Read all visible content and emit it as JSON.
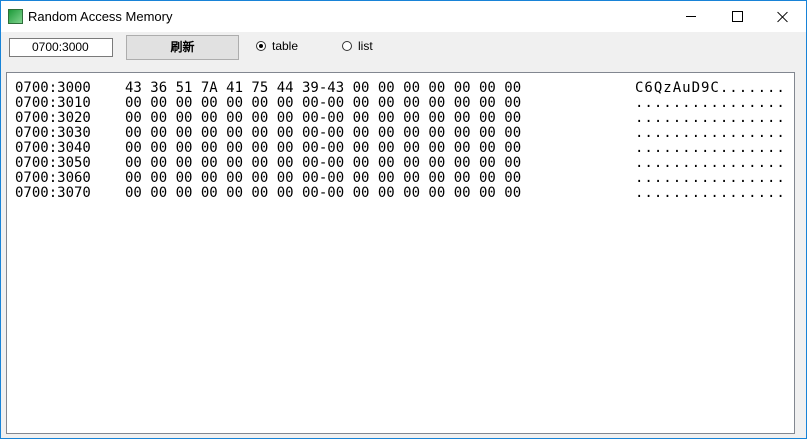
{
  "window": {
    "title": "Random Access Memory",
    "minimize_symbol": "minimize",
    "maximize_symbol": "maximize",
    "close_symbol": "close"
  },
  "toolbar": {
    "address_value": "0700:3000",
    "refresh_label": "刷新",
    "radio_table_label": "table",
    "radio_list_label": "list",
    "selected_mode": "table"
  },
  "memory": {
    "rows": [
      {
        "addr": "0700:3000",
        "hex": "43 36 51 7A 41 75 44 39-43 00 00 00 00 00 00 00",
        "ascii": "C6QzAuD9C......."
      },
      {
        "addr": "0700:3010",
        "hex": "00 00 00 00 00 00 00 00-00 00 00 00 00 00 00 00",
        "ascii": "................"
      },
      {
        "addr": "0700:3020",
        "hex": "00 00 00 00 00 00 00 00-00 00 00 00 00 00 00 00",
        "ascii": "................"
      },
      {
        "addr": "0700:3030",
        "hex": "00 00 00 00 00 00 00 00-00 00 00 00 00 00 00 00",
        "ascii": "................"
      },
      {
        "addr": "0700:3040",
        "hex": "00 00 00 00 00 00 00 00-00 00 00 00 00 00 00 00",
        "ascii": "................"
      },
      {
        "addr": "0700:3050",
        "hex": "00 00 00 00 00 00 00 00-00 00 00 00 00 00 00 00",
        "ascii": "................"
      },
      {
        "addr": "0700:3060",
        "hex": "00 00 00 00 00 00 00 00-00 00 00 00 00 00 00 00",
        "ascii": "................"
      },
      {
        "addr": "0700:3070",
        "hex": "00 00 00 00 00 00 00 00-00 00 00 00 00 00 00 00",
        "ascii": "................"
      }
    ]
  }
}
